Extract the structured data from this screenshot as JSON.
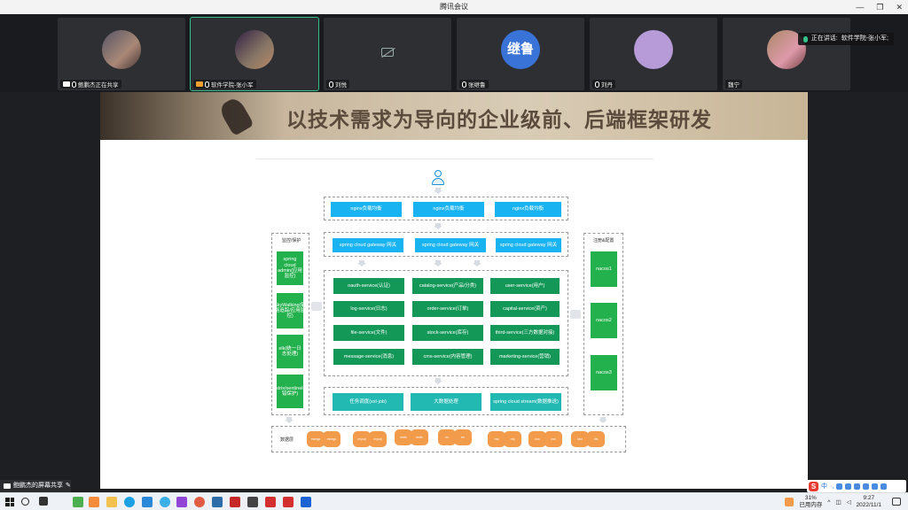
{
  "window": {
    "title": "腾讯会议"
  },
  "participants": [
    {
      "name": "鲍鹏杰正在共享",
      "sharing": true,
      "avatar": "photo"
    },
    {
      "name": "软件学院-张小军",
      "active": true,
      "avatar": "photo2"
    },
    {
      "name": "刘悦",
      "camera_off": true
    },
    {
      "name": "张继鲁",
      "avatar": "blue",
      "avatar_text": "继鲁"
    },
    {
      "name": "刘丹",
      "avatar": "pink"
    },
    {
      "name": "魏宁",
      "avatar": "photo3"
    }
  ],
  "speaking": {
    "label": "正在讲话:",
    "name": "软件学院-张小军;"
  },
  "slide": {
    "title": "以技术需求为导向的企业级前、后端框架研发",
    "diagram": {
      "nginx": [
        "nginx负载均衡",
        "nginx负载均衡",
        "nginx负载均衡"
      ],
      "gateways": [
        "spring cloud gateway 网关",
        "spring cloud gateway 网关",
        "spring cloud gateway 网关"
      ],
      "services": [
        [
          "oauth-service(认证)",
          "catalog-service(产品/分类)",
          "user-service(用户)"
        ],
        [
          "log-service(日志)",
          "order-service(订单)",
          "capital-service(资产)"
        ],
        [
          "file-service(文件)",
          "stock-service(库存)",
          "third-service(三方数据对接)"
        ],
        [
          "message-service(消息)",
          "cms-service(内容管理)",
          "marketing-service(营销)"
        ]
      ],
      "bottom_row": [
        "任务调度(xxl-job)",
        "大数据处理",
        "spring cloud stream(数据推送)"
      ],
      "left_panel": {
        "label": "监控/保护",
        "items": [
          "spring cloud admin(应用监控)",
          "SkyWalking(链路追踪/应用监控)",
          "elk(统一日志处理)",
          "hystrix/sentinel(容错保护)"
        ]
      },
      "right_panel": {
        "label": "注册&配置",
        "items": [
          "nacos1",
          "nacos2",
          "nacos3"
        ]
      },
      "db_label": "数据层",
      "databases": [
        "mongo",
        "mongo",
        "mysql",
        "mysql",
        "redis",
        "redis",
        "es",
        "es",
        "mq",
        "mq",
        "oss",
        "oss",
        "fast",
        "dfs"
      ]
    }
  },
  "share_bar": {
    "label": "鲍鹏杰的屏幕共享"
  },
  "tray": {
    "battery": "31%",
    "battery_label": "已用内存",
    "time": "9:27",
    "date": "2022/11/1"
  }
}
